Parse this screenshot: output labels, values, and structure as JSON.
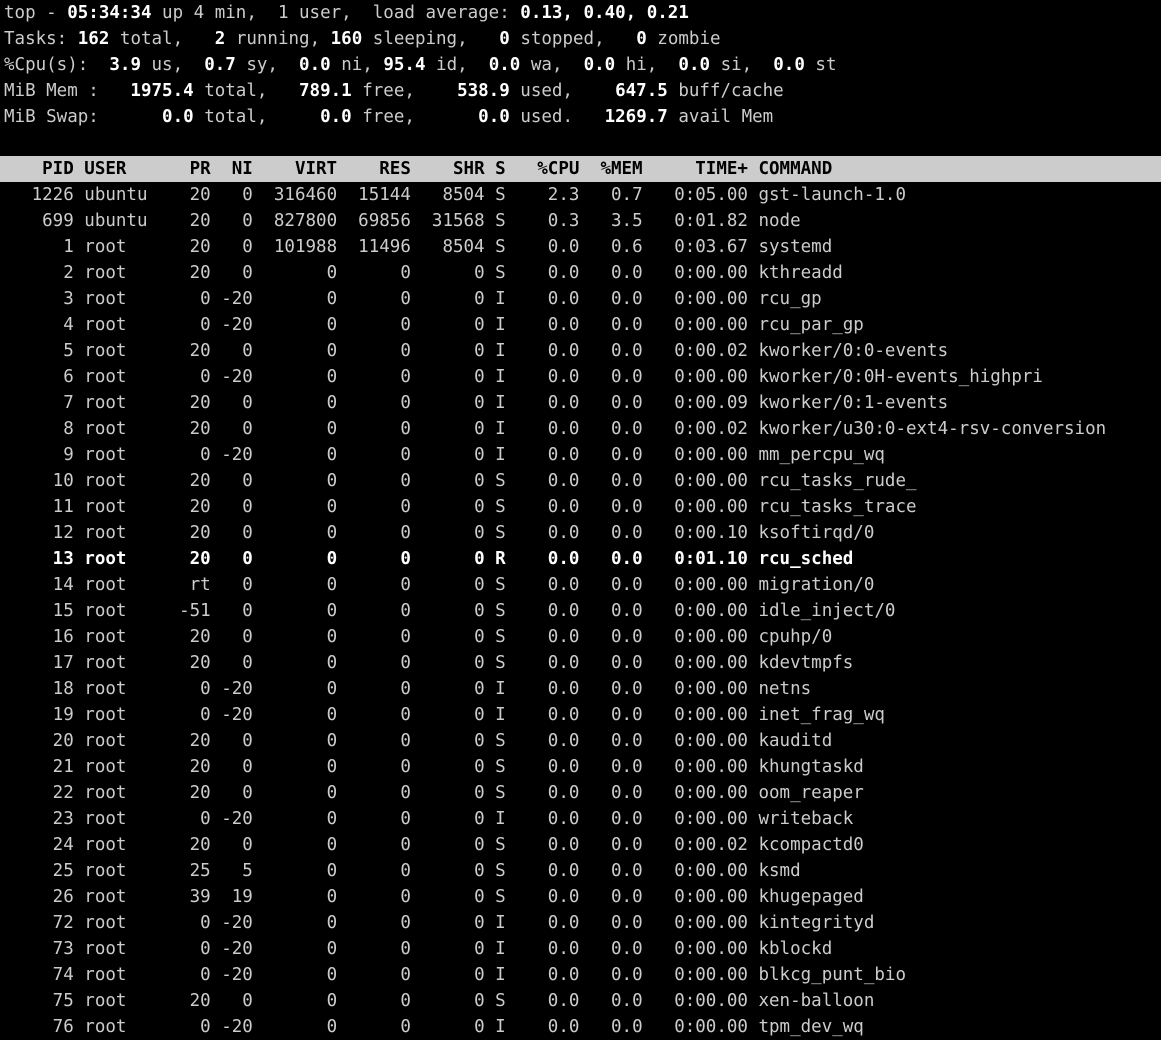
{
  "summary": {
    "line1_prefix": "top - ",
    "time": "05:34:34",
    "uptime": " up 4 min,  1 user,  load average: ",
    "loadavg": "0.13, 0.40, 0.21",
    "tasks_label": "Tasks:",
    "tasks_total": " 162 ",
    "tasks_total_lbl": "total,   ",
    "tasks_running": "2 ",
    "tasks_running_lbl": "running, ",
    "tasks_sleeping": "160 ",
    "tasks_sleeping_lbl": "sleeping,   ",
    "tasks_stopped": "0 ",
    "tasks_stopped_lbl": "stopped,   ",
    "tasks_zombie": "0 ",
    "tasks_zombie_lbl": "zombie",
    "cpu_label": "%Cpu(s):",
    "cpu_us": "  3.9 ",
    "cpu_us_lbl": "us,  ",
    "cpu_sy": "0.7 ",
    "cpu_sy_lbl": "sy,  ",
    "cpu_ni": "0.0 ",
    "cpu_ni_lbl": "ni, ",
    "cpu_id": "95.4 ",
    "cpu_id_lbl": "id,  ",
    "cpu_wa": "0.0 ",
    "cpu_wa_lbl": "wa,  ",
    "cpu_hi": "0.0 ",
    "cpu_hi_lbl": "hi,  ",
    "cpu_si": "0.0 ",
    "cpu_si_lbl": "si,  ",
    "cpu_st": "0.0 ",
    "cpu_st_lbl": "st",
    "mem_label": "MiB Mem :",
    "mem_total": "   1975.4 ",
    "mem_total_lbl": "total,   ",
    "mem_free": "789.1 ",
    "mem_free_lbl": "free,    ",
    "mem_used": "538.9 ",
    "mem_used_lbl": "used,    ",
    "mem_buff": "647.5 ",
    "mem_buff_lbl": "buff/cache",
    "swap_label": "MiB Swap:",
    "swap_total": "      0.0 ",
    "swap_total_lbl": "total,     ",
    "swap_free": "0.0 ",
    "swap_free_lbl": "free,      ",
    "swap_used": "0.0 ",
    "swap_used_lbl": "used.   ",
    "swap_avail": "1269.7 ",
    "swap_avail_lbl": "avail Mem"
  },
  "headers": {
    "pid": "PID",
    "user": "USER",
    "pr": "PR",
    "ni": "NI",
    "virt": "VIRT",
    "res": "RES",
    "shr": "SHR",
    "s": "S",
    "cpu": "%CPU",
    "mem": "%MEM",
    "time": "TIME+",
    "cmd": "COMMAND"
  },
  "rows": [
    {
      "pid": "1226",
      "user": "ubuntu",
      "pr": "20",
      "ni": "0",
      "virt": "316460",
      "res": "15144",
      "shr": "8504",
      "s": "S",
      "cpu": "2.3",
      "mem": "0.7",
      "time": "0:05.00",
      "cmd": "gst-launch-1.0",
      "bold": false
    },
    {
      "pid": "699",
      "user": "ubuntu",
      "pr": "20",
      "ni": "0",
      "virt": "827800",
      "res": "69856",
      "shr": "31568",
      "s": "S",
      "cpu": "0.3",
      "mem": "3.5",
      "time": "0:01.82",
      "cmd": "node",
      "bold": false
    },
    {
      "pid": "1",
      "user": "root",
      "pr": "20",
      "ni": "0",
      "virt": "101988",
      "res": "11496",
      "shr": "8504",
      "s": "S",
      "cpu": "0.0",
      "mem": "0.6",
      "time": "0:03.67",
      "cmd": "systemd",
      "bold": false
    },
    {
      "pid": "2",
      "user": "root",
      "pr": "20",
      "ni": "0",
      "virt": "0",
      "res": "0",
      "shr": "0",
      "s": "S",
      "cpu": "0.0",
      "mem": "0.0",
      "time": "0:00.00",
      "cmd": "kthreadd",
      "bold": false
    },
    {
      "pid": "3",
      "user": "root",
      "pr": "0",
      "ni": "-20",
      "virt": "0",
      "res": "0",
      "shr": "0",
      "s": "I",
      "cpu": "0.0",
      "mem": "0.0",
      "time": "0:00.00",
      "cmd": "rcu_gp",
      "bold": false
    },
    {
      "pid": "4",
      "user": "root",
      "pr": "0",
      "ni": "-20",
      "virt": "0",
      "res": "0",
      "shr": "0",
      "s": "I",
      "cpu": "0.0",
      "mem": "0.0",
      "time": "0:00.00",
      "cmd": "rcu_par_gp",
      "bold": false
    },
    {
      "pid": "5",
      "user": "root",
      "pr": "20",
      "ni": "0",
      "virt": "0",
      "res": "0",
      "shr": "0",
      "s": "I",
      "cpu": "0.0",
      "mem": "0.0",
      "time": "0:00.02",
      "cmd": "kworker/0:0-events",
      "bold": false
    },
    {
      "pid": "6",
      "user": "root",
      "pr": "0",
      "ni": "-20",
      "virt": "0",
      "res": "0",
      "shr": "0",
      "s": "I",
      "cpu": "0.0",
      "mem": "0.0",
      "time": "0:00.00",
      "cmd": "kworker/0:0H-events_highpri",
      "bold": false
    },
    {
      "pid": "7",
      "user": "root",
      "pr": "20",
      "ni": "0",
      "virt": "0",
      "res": "0",
      "shr": "0",
      "s": "I",
      "cpu": "0.0",
      "mem": "0.0",
      "time": "0:00.09",
      "cmd": "kworker/0:1-events",
      "bold": false
    },
    {
      "pid": "8",
      "user": "root",
      "pr": "20",
      "ni": "0",
      "virt": "0",
      "res": "0",
      "shr": "0",
      "s": "I",
      "cpu": "0.0",
      "mem": "0.0",
      "time": "0:00.02",
      "cmd": "kworker/u30:0-ext4-rsv-conversion",
      "bold": false
    },
    {
      "pid": "9",
      "user": "root",
      "pr": "0",
      "ni": "-20",
      "virt": "0",
      "res": "0",
      "shr": "0",
      "s": "I",
      "cpu": "0.0",
      "mem": "0.0",
      "time": "0:00.00",
      "cmd": "mm_percpu_wq",
      "bold": false
    },
    {
      "pid": "10",
      "user": "root",
      "pr": "20",
      "ni": "0",
      "virt": "0",
      "res": "0",
      "shr": "0",
      "s": "S",
      "cpu": "0.0",
      "mem": "0.0",
      "time": "0:00.00",
      "cmd": "rcu_tasks_rude_",
      "bold": false
    },
    {
      "pid": "11",
      "user": "root",
      "pr": "20",
      "ni": "0",
      "virt": "0",
      "res": "0",
      "shr": "0",
      "s": "S",
      "cpu": "0.0",
      "mem": "0.0",
      "time": "0:00.00",
      "cmd": "rcu_tasks_trace",
      "bold": false
    },
    {
      "pid": "12",
      "user": "root",
      "pr": "20",
      "ni": "0",
      "virt": "0",
      "res": "0",
      "shr": "0",
      "s": "S",
      "cpu": "0.0",
      "mem": "0.0",
      "time": "0:00.10",
      "cmd": "ksoftirqd/0",
      "bold": false
    },
    {
      "pid": "13",
      "user": "root",
      "pr": "20",
      "ni": "0",
      "virt": "0",
      "res": "0",
      "shr": "0",
      "s": "R",
      "cpu": "0.0",
      "mem": "0.0",
      "time": "0:01.10",
      "cmd": "rcu_sched",
      "bold": true
    },
    {
      "pid": "14",
      "user": "root",
      "pr": "rt",
      "ni": "0",
      "virt": "0",
      "res": "0",
      "shr": "0",
      "s": "S",
      "cpu": "0.0",
      "mem": "0.0",
      "time": "0:00.00",
      "cmd": "migration/0",
      "bold": false
    },
    {
      "pid": "15",
      "user": "root",
      "pr": "-51",
      "ni": "0",
      "virt": "0",
      "res": "0",
      "shr": "0",
      "s": "S",
      "cpu": "0.0",
      "mem": "0.0",
      "time": "0:00.00",
      "cmd": "idle_inject/0",
      "bold": false
    },
    {
      "pid": "16",
      "user": "root",
      "pr": "20",
      "ni": "0",
      "virt": "0",
      "res": "0",
      "shr": "0",
      "s": "S",
      "cpu": "0.0",
      "mem": "0.0",
      "time": "0:00.00",
      "cmd": "cpuhp/0",
      "bold": false
    },
    {
      "pid": "17",
      "user": "root",
      "pr": "20",
      "ni": "0",
      "virt": "0",
      "res": "0",
      "shr": "0",
      "s": "S",
      "cpu": "0.0",
      "mem": "0.0",
      "time": "0:00.00",
      "cmd": "kdevtmpfs",
      "bold": false
    },
    {
      "pid": "18",
      "user": "root",
      "pr": "0",
      "ni": "-20",
      "virt": "0",
      "res": "0",
      "shr": "0",
      "s": "I",
      "cpu": "0.0",
      "mem": "0.0",
      "time": "0:00.00",
      "cmd": "netns",
      "bold": false
    },
    {
      "pid": "19",
      "user": "root",
      "pr": "0",
      "ni": "-20",
      "virt": "0",
      "res": "0",
      "shr": "0",
      "s": "I",
      "cpu": "0.0",
      "mem": "0.0",
      "time": "0:00.00",
      "cmd": "inet_frag_wq",
      "bold": false
    },
    {
      "pid": "20",
      "user": "root",
      "pr": "20",
      "ni": "0",
      "virt": "0",
      "res": "0",
      "shr": "0",
      "s": "S",
      "cpu": "0.0",
      "mem": "0.0",
      "time": "0:00.00",
      "cmd": "kauditd",
      "bold": false
    },
    {
      "pid": "21",
      "user": "root",
      "pr": "20",
      "ni": "0",
      "virt": "0",
      "res": "0",
      "shr": "0",
      "s": "S",
      "cpu": "0.0",
      "mem": "0.0",
      "time": "0:00.00",
      "cmd": "khungtaskd",
      "bold": false
    },
    {
      "pid": "22",
      "user": "root",
      "pr": "20",
      "ni": "0",
      "virt": "0",
      "res": "0",
      "shr": "0",
      "s": "S",
      "cpu": "0.0",
      "mem": "0.0",
      "time": "0:00.00",
      "cmd": "oom_reaper",
      "bold": false
    },
    {
      "pid": "23",
      "user": "root",
      "pr": "0",
      "ni": "-20",
      "virt": "0",
      "res": "0",
      "shr": "0",
      "s": "I",
      "cpu": "0.0",
      "mem": "0.0",
      "time": "0:00.00",
      "cmd": "writeback",
      "bold": false
    },
    {
      "pid": "24",
      "user": "root",
      "pr": "20",
      "ni": "0",
      "virt": "0",
      "res": "0",
      "shr": "0",
      "s": "S",
      "cpu": "0.0",
      "mem": "0.0",
      "time": "0:00.02",
      "cmd": "kcompactd0",
      "bold": false
    },
    {
      "pid": "25",
      "user": "root",
      "pr": "25",
      "ni": "5",
      "virt": "0",
      "res": "0",
      "shr": "0",
      "s": "S",
      "cpu": "0.0",
      "mem": "0.0",
      "time": "0:00.00",
      "cmd": "ksmd",
      "bold": false
    },
    {
      "pid": "26",
      "user": "root",
      "pr": "39",
      "ni": "19",
      "virt": "0",
      "res": "0",
      "shr": "0",
      "s": "S",
      "cpu": "0.0",
      "mem": "0.0",
      "time": "0:00.00",
      "cmd": "khugepaged",
      "bold": false
    },
    {
      "pid": "72",
      "user": "root",
      "pr": "0",
      "ni": "-20",
      "virt": "0",
      "res": "0",
      "shr": "0",
      "s": "I",
      "cpu": "0.0",
      "mem": "0.0",
      "time": "0:00.00",
      "cmd": "kintegrityd",
      "bold": false
    },
    {
      "pid": "73",
      "user": "root",
      "pr": "0",
      "ni": "-20",
      "virt": "0",
      "res": "0",
      "shr": "0",
      "s": "I",
      "cpu": "0.0",
      "mem": "0.0",
      "time": "0:00.00",
      "cmd": "kblockd",
      "bold": false
    },
    {
      "pid": "74",
      "user": "root",
      "pr": "0",
      "ni": "-20",
      "virt": "0",
      "res": "0",
      "shr": "0",
      "s": "I",
      "cpu": "0.0",
      "mem": "0.0",
      "time": "0:00.00",
      "cmd": "blkcg_punt_bio",
      "bold": false
    },
    {
      "pid": "75",
      "user": "root",
      "pr": "20",
      "ni": "0",
      "virt": "0",
      "res": "0",
      "shr": "0",
      "s": "S",
      "cpu": "0.0",
      "mem": "0.0",
      "time": "0:00.00",
      "cmd": "xen-balloon",
      "bold": false
    },
    {
      "pid": "76",
      "user": "root",
      "pr": "0",
      "ni": "-20",
      "virt": "0",
      "res": "0",
      "shr": "0",
      "s": "I",
      "cpu": "0.0",
      "mem": "0.0",
      "time": "0:00.00",
      "cmd": "tpm_dev_wq",
      "bold": false
    }
  ]
}
